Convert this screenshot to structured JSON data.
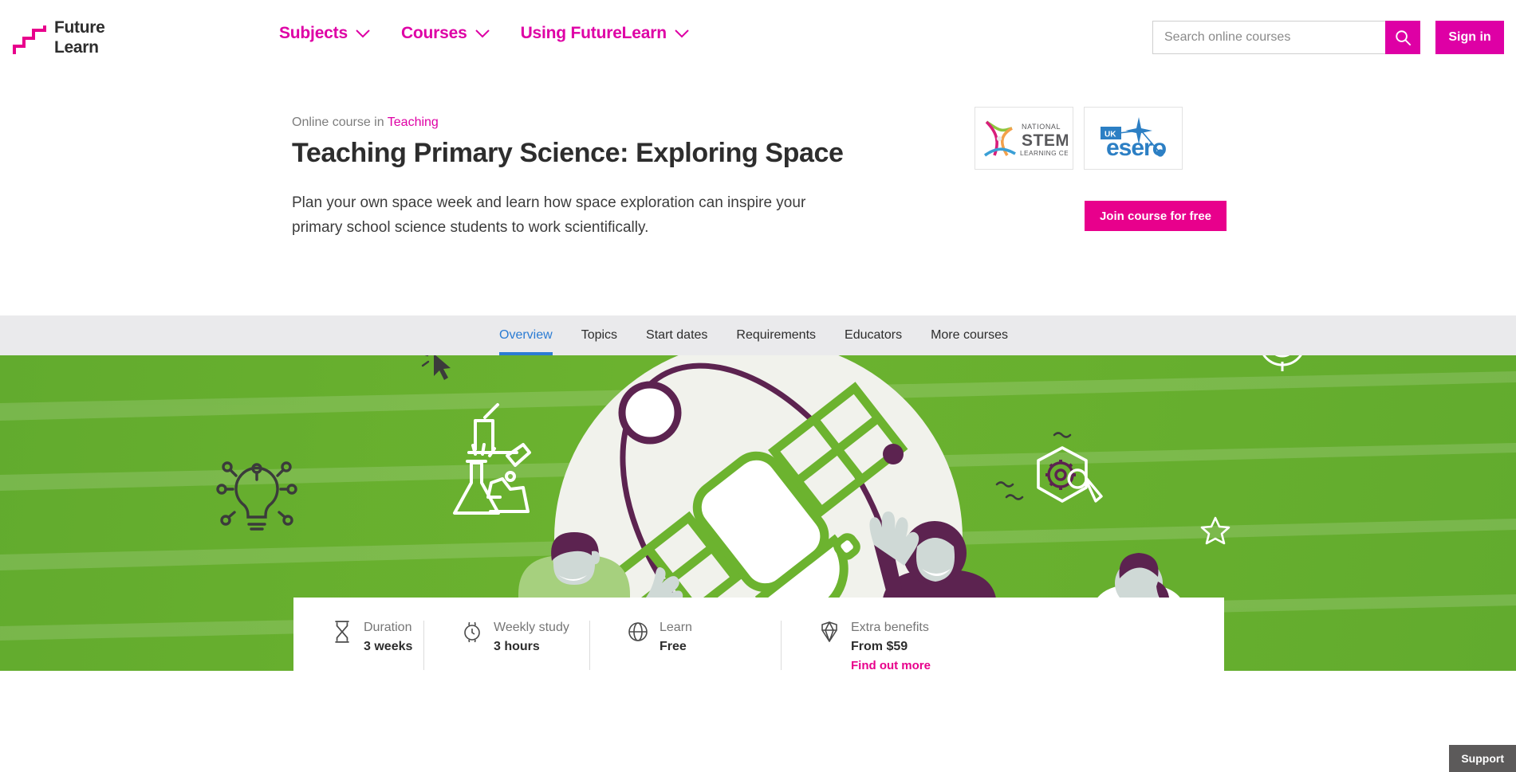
{
  "brand": {
    "name_line1": "Future",
    "name_line2": "Learn",
    "accent": "#de00a5",
    "green": "#6cb32f",
    "purple": "#5c2350",
    "blue": "#2b7cd3"
  },
  "header": {
    "nav": [
      {
        "label": "Subjects",
        "icon": "chevron-down-icon"
      },
      {
        "label": "Courses",
        "icon": "chevron-down-icon"
      },
      {
        "label": "Using FutureLearn",
        "icon": "chevron-down-icon"
      }
    ],
    "search": {
      "placeholder": "Search online courses",
      "value": "",
      "icon": "search-icon"
    },
    "signin_label": "Sign in"
  },
  "intro": {
    "eyebrow_prefix": "Online course in ",
    "eyebrow_link": "Teaching",
    "title": "Teaching Primary Science: Exploring Space",
    "description": "Plan your own space week and learn how space exploration can inspire your primary school science students to work scientifically.",
    "join_label": "Join course for free",
    "partners": [
      {
        "name": "National STEM Learning Centre",
        "line1": "NATIONAL",
        "line2": "STEM",
        "line3": "LEARNING CENTRE"
      },
      {
        "name": "UK ESERO",
        "badge": "UK",
        "wordmark": "esero"
      }
    ]
  },
  "tabs": [
    {
      "label": "Overview",
      "active": true
    },
    {
      "label": "Topics",
      "active": false
    },
    {
      "label": "Start dates",
      "active": false
    },
    {
      "label": "Requirements",
      "active": false
    },
    {
      "label": "Educators",
      "active": false
    },
    {
      "label": "More courses",
      "active": false
    }
  ],
  "hero": {
    "illustration": "satellite-orbiting-planet-with-students",
    "decorative_icons": [
      "microscope-icon",
      "flask-icon",
      "lightbulb-icon",
      "cursor-click-icon",
      "pie-chart-icon",
      "target-dart-icon",
      "gear-wrench-icon",
      "star-icon"
    ]
  },
  "stats": [
    {
      "icon": "hourglass-icon",
      "label": "Duration",
      "value": "3 weeks"
    },
    {
      "icon": "watch-icon",
      "label": "Weekly study",
      "value": "3 hours"
    },
    {
      "icon": "globe-icon",
      "label": "Learn",
      "value": "Free"
    },
    {
      "icon": "diamond-icon",
      "label": "Extra benefits",
      "value": "From $59",
      "link": "Find out more"
    }
  ],
  "support": {
    "label": "Support"
  }
}
